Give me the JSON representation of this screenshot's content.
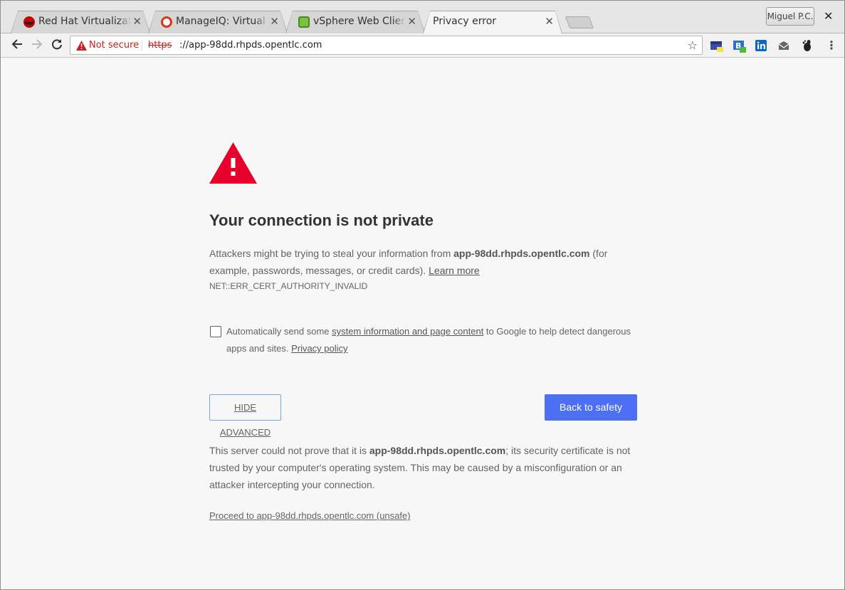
{
  "tabs": [
    {
      "title": "Red Hat Virtualizatio",
      "favicon": "redhat-icon"
    },
    {
      "title": "ManageIQ: Virtual M",
      "favicon": "manageiq-icon"
    },
    {
      "title": "vSphere Web Client",
      "favicon": "vsphere-icon"
    },
    {
      "title": "Privacy error",
      "favicon": ""
    }
  ],
  "window": {
    "profile_label": "Miguel P.C.",
    "close_glyph": "✕"
  },
  "toolbar": {
    "security_label": "Not secure",
    "url_scheme": "https",
    "url_rest": "://app-98dd.rhpds.opentlc.com"
  },
  "page": {
    "heading": "Your connection is not private",
    "intro_before": "Attackers might be trying to steal your information from ",
    "host": "app-98dd.rhpds.opentlc.com",
    "intro_after": " (for example, passwords, messages, or credit cards). ",
    "learn_more": "Learn more",
    "error_code": "NET::ERR_CERT_AUTHORITY_INVALID",
    "optin_before": "Automatically send some ",
    "optin_link": "system information and page content",
    "optin_after": " to Google to help detect dangerous apps and sites. ",
    "privacy_policy": "Privacy policy",
    "hide_advanced": "HIDE ADVANCED",
    "back_to_safety": "Back to safety",
    "details_before": "This server could not prove that it is ",
    "details_host": "app-98dd.rhpds.opentlc.com",
    "details_after": "; its security certificate is not trusted by your computer's operating system. This may be caused by a misconfiguration or an attacker intercepting your connection.",
    "proceed_link": "Proceed to app-98dd.rhpds.opentlc.com (unsafe)"
  },
  "colors": {
    "warning_red": "#e8002d",
    "primary_blue": "#4d6ff3",
    "not_secure_red": "#c5221f"
  }
}
